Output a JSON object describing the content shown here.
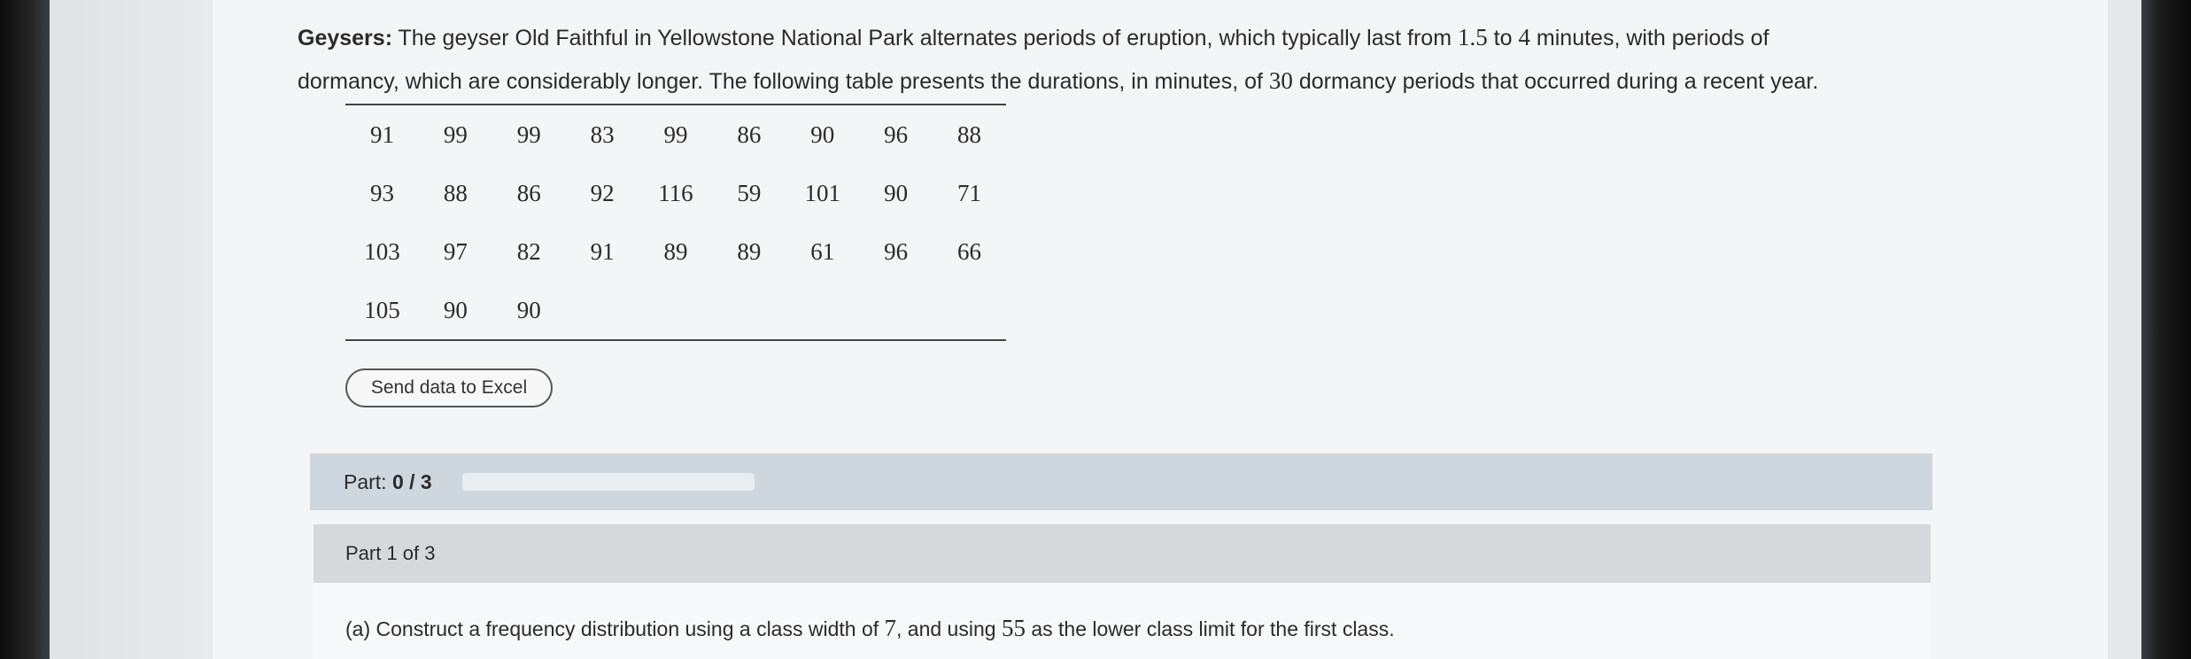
{
  "question": {
    "heading": "Geysers:",
    "text_line1_a": "The geyser Old Faithful in Yellowstone National Park alternates periods of eruption, which typically last from ",
    "value_low": "1.5",
    "text_to": " to ",
    "value_high": "4",
    "text_line1_b": " minutes, with periods of",
    "text_line2_a": "dormancy, which are considerably longer. The following table presents the durations, in minutes, of ",
    "value_count": "30",
    "text_line2_b": " dormancy periods that occurred during a recent year."
  },
  "table": {
    "rows": [
      [
        "91",
        "99",
        "99",
        "83",
        "99",
        "86",
        "90",
        "96",
        "88"
      ],
      [
        "93",
        "88",
        "86",
        "92",
        "116",
        "59",
        "101",
        "90",
        "71"
      ],
      [
        "103",
        "97",
        "82",
        "91",
        "89",
        "89",
        "61",
        "96",
        "66"
      ],
      [
        "105",
        "90",
        "90",
        "",
        "",
        "",
        "",
        "",
        ""
      ]
    ]
  },
  "excel_button_label": "Send data to Excel",
  "progress": {
    "label_prefix": "Part: ",
    "value_text": "0 / 3",
    "fraction": 0
  },
  "part_header": "Part 1 of 3",
  "part_prompt": {
    "a": "(a) Construct a frequency distribution using a class width of ",
    "width": "7",
    "b": ", and using ",
    "lower": "55",
    "c": " as the lower class limit for the first class."
  },
  "tools": [
    "infinity-icon",
    "hint-icon",
    "reference-icon",
    "calculator-icon",
    "mail-icon",
    "chart-icon",
    "data-icon"
  ],
  "colors": {
    "part_bar": "#cfd7de",
    "part_header": "#d6d9dc",
    "content_bg": "#f4f5f6"
  }
}
